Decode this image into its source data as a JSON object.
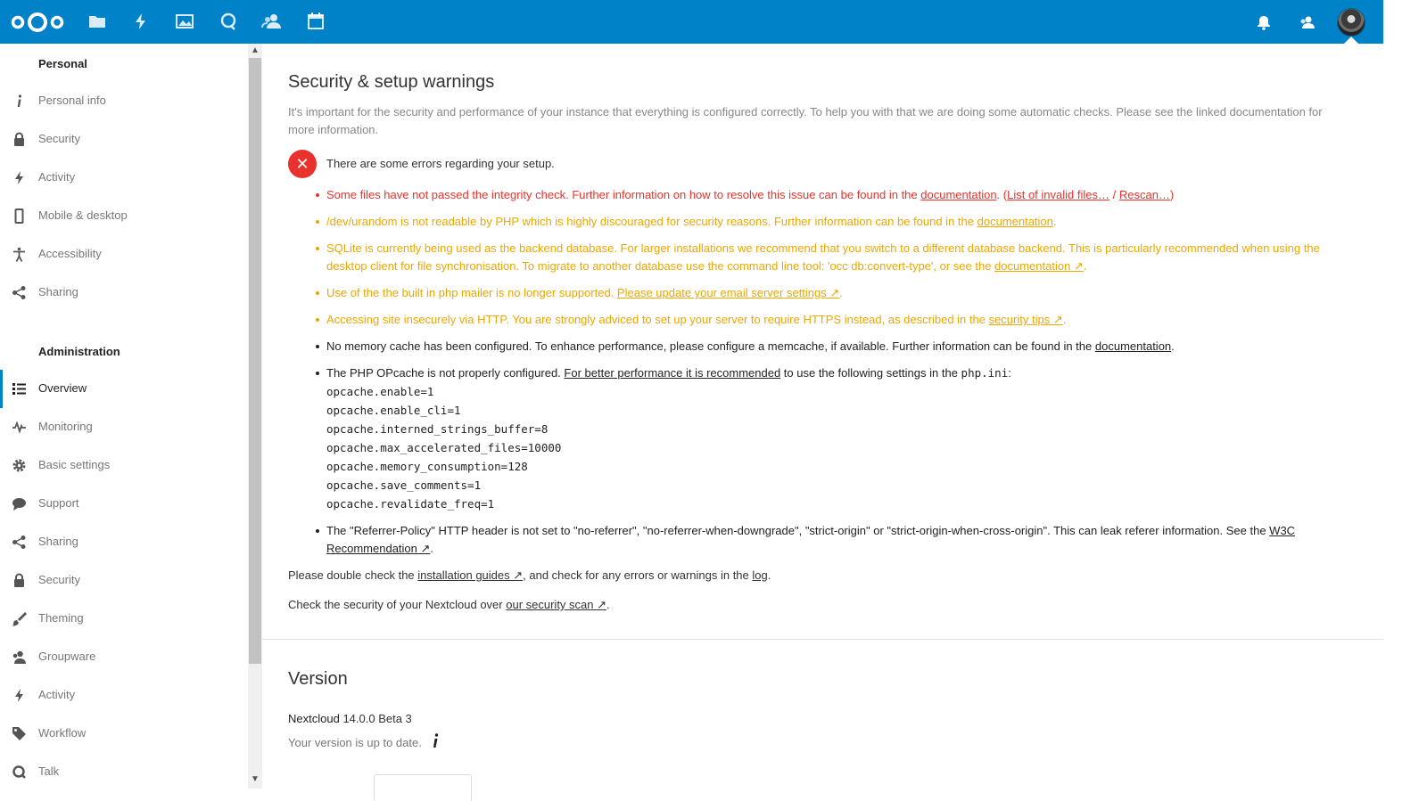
{
  "header": {
    "apps": [
      "files",
      "activity",
      "photos",
      "talk",
      "contacts",
      "calendar"
    ],
    "right_icons": [
      "notifications",
      "contacts-menu",
      "user-avatar"
    ],
    "brand_color": "#0082c9"
  },
  "sidebar": {
    "personal_title": "Personal",
    "personal_items": [
      {
        "label": "Personal info",
        "icon": "info-icon"
      },
      {
        "label": "Security",
        "icon": "lock-icon"
      },
      {
        "label": "Activity",
        "icon": "activity-icon"
      },
      {
        "label": "Mobile & desktop",
        "icon": "phone-icon"
      },
      {
        "label": "Accessibility",
        "icon": "accessibility-icon"
      },
      {
        "label": "Sharing",
        "icon": "share-icon"
      }
    ],
    "admin_title": "Administration",
    "admin_items": [
      {
        "label": "Overview",
        "icon": "list-icon",
        "active": true
      },
      {
        "label": "Monitoring",
        "icon": "monitoring-icon"
      },
      {
        "label": "Basic settings",
        "icon": "gear-icon"
      },
      {
        "label": "Support",
        "icon": "comment-icon"
      },
      {
        "label": "Sharing",
        "icon": "share-icon"
      },
      {
        "label": "Security",
        "icon": "lock-icon"
      },
      {
        "label": "Theming",
        "icon": "brush-icon"
      },
      {
        "label": "Groupware",
        "icon": "groupware-icon"
      },
      {
        "label": "Activity",
        "icon": "activity-icon"
      },
      {
        "label": "Workflow",
        "icon": "tag-icon"
      },
      {
        "label": "Talk",
        "icon": "talk-icon"
      }
    ]
  },
  "main": {
    "security": {
      "title": "Security & setup warnings",
      "intro": "It's important for the security and performance of your instance that everything is configured correctly. To help you with that we are doing some automatic checks. Please see the linked documentation for more information.",
      "error_summary": "There are some errors regarding your setup.",
      "w1": {
        "text": "Some files have not passed the integrity check. Further information on how to resolve this issue can be found in the ",
        "link": "documentation",
        "mid": ". (",
        "link2": "List of invalid files…",
        "sep": " / ",
        "link3": "Rescan…",
        "end": ")"
      },
      "w2": {
        "text": "/dev/urandom is not readable by PHP which is highly discouraged for security reasons. Further information can be found in the ",
        "link": "documentation",
        "end": "."
      },
      "w3": {
        "text": "SQLite is currently being used as the backend database. For larger installations we recommend that you switch to a different database backend. This is particularly recommended when using the desktop client for file synchronisation. To migrate to another database use the command line tool: 'occ db:convert-type', or see the ",
        "link": "documentation ↗",
        "end": "."
      },
      "w4": {
        "text": "Use of the the built in php mailer is no longer supported. ",
        "link": "Please update your email server settings ↗",
        "end": "."
      },
      "w5": {
        "text": "Accessing site insecurely via HTTP. You are strongly adviced to set up your server to require HTTPS instead, as described in the ",
        "link": "security tips ↗",
        "end": "."
      },
      "w6": {
        "text": "No memory cache has been configured. To enhance performance, please configure a memcache, if available. Further information can be found in the ",
        "link": "documentation",
        "end": "."
      },
      "w7": {
        "text": "The PHP OPcache is not properly configured. ",
        "link": "For better performance it is recommended",
        "mid": " to use the following settings in the ",
        "file": "php.ini",
        "end": ":",
        "settings": [
          "opcache.enable=1",
          "opcache.enable_cli=1",
          "opcache.interned_strings_buffer=8",
          "opcache.max_accelerated_files=10000",
          "opcache.memory_consumption=128",
          "opcache.save_comments=1",
          "opcache.revalidate_freq=1"
        ]
      },
      "w8": {
        "text": "The \"Referrer-Policy\" HTTP header is not set to \"no-referrer\", \"no-referrer-when-downgrade\", \"strict-origin\" or \"strict-origin-when-cross-origin\". This can leak referer information. See the ",
        "link": "W3C Recommendation ↗",
        "end": "."
      },
      "guides": {
        "pre": "Please double check the ",
        "link": "installation guides ↗",
        "mid": ", and check for any errors or warnings in the ",
        "link2": "log",
        "end": "."
      },
      "scan": {
        "pre": "Check the security of your Nextcloud over ",
        "link": "our security scan ↗",
        "end": "."
      }
    },
    "version": {
      "title": "Version",
      "product": "Nextcloud",
      "number": "14.0.0 Beta 3",
      "status": "Your version is up to date."
    }
  },
  "colors": {
    "error": "#e9322d",
    "warning": "#eca700",
    "text": "#222222",
    "muted": "#777777"
  }
}
